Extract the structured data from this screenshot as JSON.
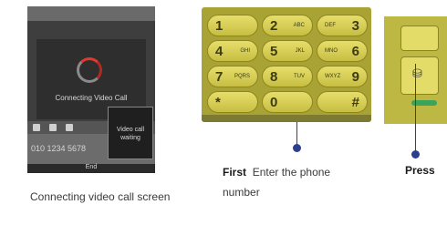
{
  "phone_screen": {
    "connecting_text": "Connecting Video Call",
    "phone_number": "010 1234 5678",
    "callee_text": "Video call waiting",
    "softkey": "End"
  },
  "captions": {
    "left": "Connecting video call screen",
    "middle_bold": "First",
    "middle_text": "Enter the phone number",
    "right": "Press"
  },
  "keypad": {
    "keys": [
      {
        "main": "1",
        "sub": "",
        "digit": "",
        "digit_sub": ""
      },
      {
        "main": "2",
        "sub": "ABC",
        "digit": "",
        "digit_sub": ""
      },
      {
        "main": "3",
        "sub": "DEF",
        "digit": "",
        "digit_sub": ""
      },
      {
        "main": "4",
        "sub": "GHI",
        "digit": "",
        "digit_sub": ""
      },
      {
        "main": "5",
        "sub": "JKL",
        "digit": "",
        "digit_sub": ""
      },
      {
        "main": "6",
        "sub": "MNO",
        "digit": "",
        "digit_sub": ""
      },
      {
        "main": "7",
        "sub": "PQRS",
        "digit": "",
        "digit_sub": ""
      },
      {
        "main": "8",
        "sub": "TUV",
        "digit": "",
        "digit_sub": ""
      },
      {
        "main": "9",
        "sub": "WXYZ",
        "digit": "",
        "digit_sub": ""
      },
      {
        "main": "*",
        "sub": "",
        "digit": "",
        "digit_sub": ""
      },
      {
        "main": "0",
        "sub": "",
        "digit": "",
        "digit_sub": ""
      },
      {
        "main": "#",
        "sub": "",
        "digit": "",
        "digit_sub": ""
      }
    ]
  },
  "colors": {
    "accent": "#2b3f8e",
    "keypad_gold": "#c7bf43",
    "spinner_red": "#e03a2f",
    "green_key": "#3aa55a"
  }
}
